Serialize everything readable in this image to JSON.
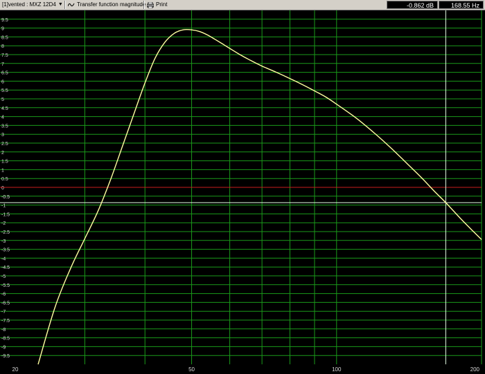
{
  "toolbar": {
    "project": "[1]vented : MXZ 12D4",
    "mode": "Transfer function magnitude",
    "print": "Print",
    "readout_db": "-0.862 dB",
    "readout_freq": "168.55 Hz"
  },
  "icons": {
    "dropdown": "chevron-down-icon",
    "transfer": "transfer-wave-icon",
    "print": "printer-icon"
  },
  "colors": {
    "grid": "#1a9a1a",
    "curve": "#ffffa0",
    "zero_line": "#c81e1e",
    "cursor": "#e6ffe6",
    "background": "#000000"
  },
  "chart_data": {
    "type": "line",
    "x_scale": "log",
    "xlim": [
      20,
      200
    ],
    "ylim": [
      -10,
      10
    ],
    "x_ticks": [
      20,
      50,
      100,
      200
    ],
    "y_ticks": [
      "9.5",
      "9",
      "8.5",
      "8",
      "7.5",
      "7",
      "6.5",
      "6",
      "5.5",
      "5",
      "4.5",
      "4",
      "3.5",
      "3",
      "2.5",
      "2",
      "1.5",
      "1",
      "0.5",
      "0",
      "-0.5",
      "-1",
      "-1.5",
      "-2",
      "-2.5",
      "-3",
      "-3.5",
      "-4",
      "-4.5",
      "-5",
      "-5.5",
      "-6",
      "-6.5",
      "-7",
      "-7.5",
      "-8",
      "-8.5",
      "-9",
      "-9.5"
    ],
    "series": [
      {
        "x": [
          24,
          26,
          28,
          30,
          32,
          34,
          36,
          38,
          40,
          42,
          44,
          46,
          48,
          50,
          52,
          54,
          56,
          58,
          60,
          63,
          66,
          70,
          75,
          80,
          85,
          90,
          95,
          100,
          110,
          120,
          130,
          140,
          150,
          160,
          168.55,
          180,
          190,
          200
        ],
        "y": [
          -10.0,
          -6.8,
          -4.6,
          -2.9,
          -1.3,
          0.5,
          2.4,
          4.2,
          5.9,
          7.3,
          8.2,
          8.7,
          8.9,
          8.9,
          8.8,
          8.6,
          8.35,
          8.1,
          7.85,
          7.5,
          7.2,
          6.85,
          6.5,
          6.15,
          5.8,
          5.45,
          5.1,
          4.7,
          3.9,
          3.05,
          2.2,
          1.35,
          0.55,
          -0.25,
          -0.862,
          -1.7,
          -2.35,
          -2.95
        ]
      }
    ],
    "cursor": {
      "x": 168.55,
      "y": -0.862
    },
    "zero_line": 0
  }
}
